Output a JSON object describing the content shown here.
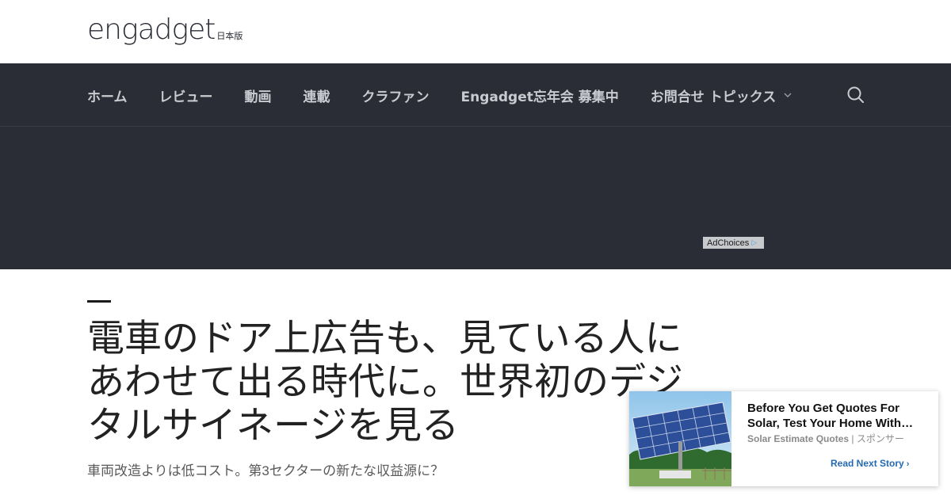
{
  "brand": {
    "logo_text": "engadget",
    "edition": "日本版"
  },
  "nav": {
    "items": [
      {
        "label": "ホーム"
      },
      {
        "label": "レビュー"
      },
      {
        "label": "動画"
      },
      {
        "label": "連載"
      },
      {
        "label": "クラファン"
      },
      {
        "label": "Engadget忘年会 募集中"
      },
      {
        "label": "お問合せ トピックス"
      }
    ],
    "search_icon": "search-icon",
    "dropdown_icon": "chevron-down-icon"
  },
  "ad": {
    "adchoices_label": "AdChoices"
  },
  "article": {
    "headline": "電車のドア上広告も、見ている人にあわせて出る時代に。世界初のデジタルサイネージを見る",
    "subheadline": "車両改造よりは低コスト。第3セクターの新たな収益源に？"
  },
  "promo": {
    "title_line1": "Before You Get Quotes For",
    "title_line2": "Solar, Test Your Home With…",
    "advertiser": "Solar Estimate Quotes",
    "separator": "|",
    "sponsor_label": "スポンサー",
    "cta": "Read Next Story"
  },
  "colors": {
    "navbar_bg": "#2b2d36",
    "nav_text": "#c9cbd1",
    "headline_text": "#222222",
    "cta_blue": "#2369b3"
  }
}
